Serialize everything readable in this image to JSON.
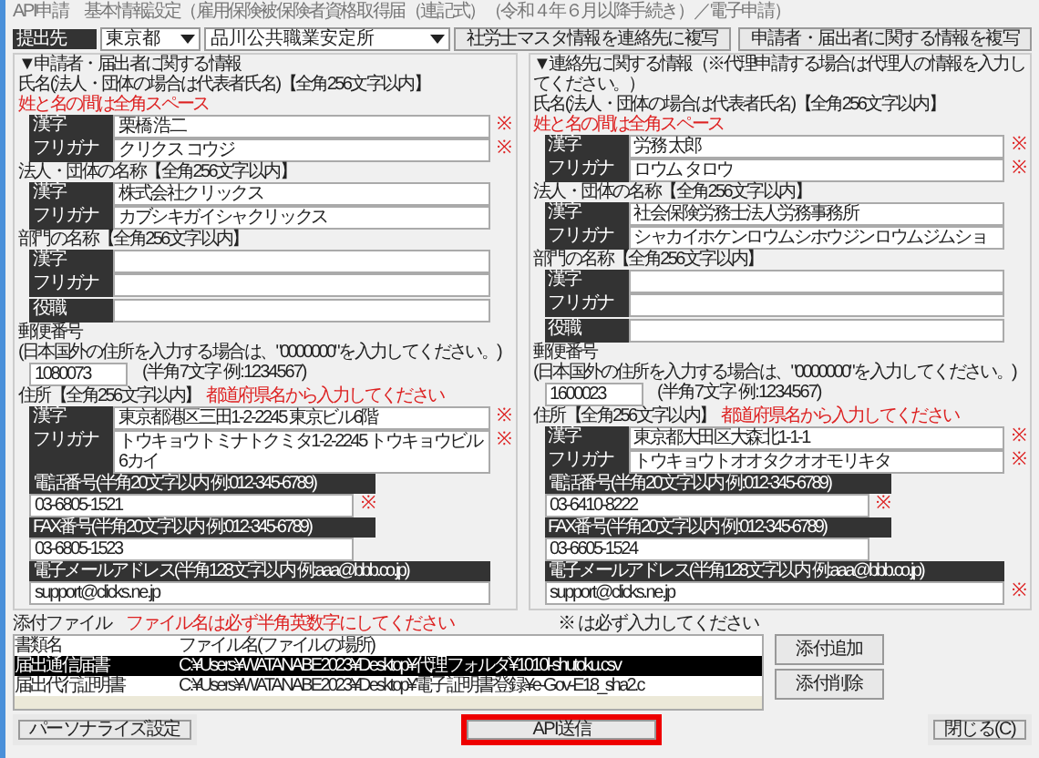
{
  "window": {
    "title": "API申請　基本情報設定（雇用保険被保険者資格取得届（連記式）（令和４年６月以降手続き）／電子申請）"
  },
  "submit_to": {
    "label": "提出先",
    "prefecture": "東京都",
    "office": "品川公共職業安定所"
  },
  "top_buttons": [
    "社労士マスタ情報を連絡先に複写",
    "申請者・届出者に関する情報を複写"
  ],
  "panels": [
    {
      "title": "▼申請者・届出者に関する情報",
      "groups": [
        {
          "kind": "fields",
          "label": "氏名(法人・団体の場合は代表者氏名)【全角256文字以内】",
          "note": "姓と名の間は全角スペース",
          "rows": [
            {
              "label": "漢字",
              "value": "栗橋 浩二",
              "mark": "※"
            },
            {
              "label": "フリガナ",
              "value": "クリクス コウジ",
              "mark": "※"
            }
          ]
        },
        {
          "kind": "fields",
          "label": "法人・団体の名称【全角256文字以内】",
          "rows": [
            {
              "label": "漢字",
              "value": "株式会社クリックス"
            },
            {
              "label": "フリガナ",
              "value": "カブシキガイシャクリックス"
            }
          ]
        },
        {
          "kind": "fields",
          "label": "部門の名称【全角256文字以内】",
          "rows": [
            {
              "label": "漢字"
            },
            {
              "label": "フリガナ"
            }
          ]
        },
        {
          "kind": "fields",
          "rows": [
            {
              "label": "役職"
            }
          ]
        },
        {
          "kind": "postal",
          "label": "郵便番号",
          "hint": "(日本国外の住所を入力する場合は、\"0000000\"を入力してください。)",
          "value": "1080073",
          "format": "(半角7文字 例:1234567)"
        },
        {
          "kind": "fields",
          "label": "住所【全角256文字以内】",
          "note": "都道府県名から入力してください",
          "rows": [
            {
              "label": "漢字",
              "value": "東京都港区三田1-2-2245 東京ビル6階",
              "mark": "※"
            },
            {
              "label": "フリガナ",
              "value": "トウキョウトミナトクミタ1-2-2245 トウキョウビル6カイ",
              "mark": "※"
            }
          ]
        },
        {
          "kind": "contact",
          "label": "電話番号(半角20文字以内 例:012-345-6789)",
          "value": "03-6805-1521",
          "mark": "※"
        },
        {
          "kind": "contact",
          "label": "FAX番号(半角20文字以内 例:012-345-6789)",
          "value": "03-6805-1523"
        },
        {
          "kind": "contact_wide",
          "label": "電子メールアドレス(半角128文字以内 例:aaa@bbb.co.jp)",
          "value": "support@clicks.ne.jp"
        }
      ]
    },
    {
      "title": "▼連絡先に関する情報（※代理申請する場合は代理人の情報を入力してください。）",
      "groups": [
        {
          "kind": "fields",
          "label": "氏名(法人・団体の場合は代表者氏名)【全角256文字以内】",
          "note": "姓と名の間は全角スペース",
          "rows": [
            {
              "label": "漢字",
              "value": "労務 太郎",
              "mark": "※"
            },
            {
              "label": "フリガナ",
              "value": "ロウム タロウ",
              "mark": "※"
            }
          ]
        },
        {
          "kind": "fields",
          "label": "法人・団体の名称【全角256文字以内】",
          "rows": [
            {
              "label": "漢字",
              "value": "社会保険労務士法人労務事務所"
            },
            {
              "label": "フリガナ",
              "value": "シャカイホケンロウムシホウジンロウムジムショ"
            }
          ]
        },
        {
          "kind": "fields",
          "label": "部門の名称【全角256文字以内】",
          "rows": [
            {
              "label": "漢字"
            },
            {
              "label": "フリガナ"
            }
          ]
        },
        {
          "kind": "fields",
          "rows": [
            {
              "label": "役職"
            }
          ]
        },
        {
          "kind": "postal",
          "label": "郵便番号",
          "hint": "(日本国外の住所を入力する場合は、\"0000000\"を入力してください。)",
          "value": "1600023",
          "format": "(半角7文字 例:1234567)"
        },
        {
          "kind": "fields",
          "label": "住所【全角256文字以内】",
          "note": "都道府県名から入力してください",
          "rows": [
            {
              "label": "漢字",
              "value": "東京都大田区大森北1-1-1",
              "mark": "※"
            },
            {
              "label": "フリガナ",
              "value": "トウキョウトオオタクオオモリキタ",
              "mark": "※"
            }
          ]
        },
        {
          "kind": "contact",
          "label": "電話番号(半角20文字以内 例:012-345-6789)",
          "value": "03-6410-8222",
          "mark": "※"
        },
        {
          "kind": "contact",
          "label": "FAX番号(半角20文字以内 例:012-345-6789)",
          "value": "03-6605-1524"
        },
        {
          "kind": "contact_wide",
          "label": "電子メールアドレス(半角128文字以内 例:aaa@bbb.co.jp)",
          "value": "support@clicks.ne.jp",
          "mark": "※"
        }
      ]
    }
  ],
  "attachments": {
    "label": "添付ファイル",
    "note": "ファイル名は必ず半角英数字にしてください",
    "required_note": "※ は必ず入力してください",
    "columns": [
      "書類名",
      "ファイル名(ファイルの場所)"
    ],
    "rows": [
      {
        "name": "届出通信届書",
        "path": "C:¥Users¥WATANABE2023¥Desktop¥代理フォルダ¥1010l-shutoku.csv",
        "selected": true
      },
      {
        "name": "届出代行証明書",
        "path": "C:¥Users¥WATANABE2023¥Desktop¥電子証明書登録¥e-Gov-E18_sha2.c",
        "selected": false
      }
    ],
    "buttons": [
      "添付追加",
      "添付削除"
    ]
  },
  "footer_buttons": [
    {
      "label": "パーソナライズ設定",
      "highlighted": false
    },
    {
      "label": "API送信",
      "highlighted": true
    },
    {
      "label": "閉じる(C)",
      "highlighted": false
    }
  ]
}
